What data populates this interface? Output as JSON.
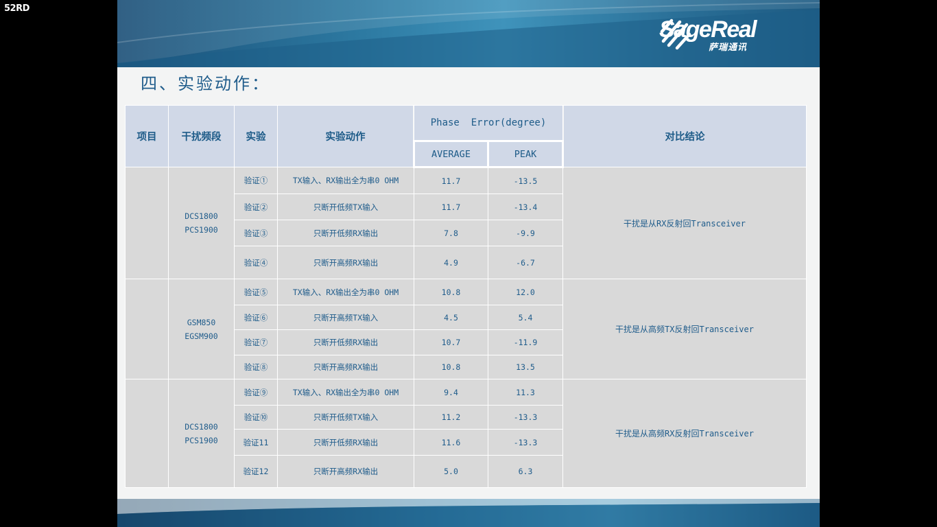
{
  "watermark": "52RD",
  "logo": {
    "name": "SageReal",
    "subtitle": "萨瑞通讯"
  },
  "title": "四、实验动作：",
  "table": {
    "headers": {
      "item": "项目",
      "band": "干扰频段",
      "experiment": "实验",
      "action": "实验动作",
      "phase_error": "Phase  Error(degree)",
      "average": "AVERAGE",
      "peak": "PEAK",
      "conclusion": "对比结论"
    },
    "groups": [
      {
        "item": "",
        "band": [
          "DCS1800",
          "PCS1900"
        ],
        "conclusion": "干扰是从RX反射回Transceiver",
        "rows": [
          {
            "exp": "验证①",
            "action": "TX输入、RX输出全为串0 OHM",
            "average": "11.7",
            "peak": "-13.5"
          },
          {
            "exp": "验证②",
            "action": "只断开低频TX输入",
            "average": "11.7",
            "peak": "-13.4"
          },
          {
            "exp": "验证③",
            "action": "只断开低频RX输出",
            "average": "7.8",
            "peak": "-9.9"
          },
          {
            "exp": "验证④",
            "action": "只断开高频RX输出",
            "average": "4.9",
            "peak": "-6.7"
          }
        ]
      },
      {
        "item": "",
        "band": [
          "GSM850",
          "EGSM900"
        ],
        "conclusion": "干扰是从高频TX反射回Transceiver",
        "rows": [
          {
            "exp": "验证⑤",
            "action": "TX输入、RX输出全为串0 OHM",
            "average": "10.8",
            "peak": "12.0"
          },
          {
            "exp": "验证⑥",
            "action": "只断开高频TX输入",
            "average": "4.5",
            "peak": "5.4"
          },
          {
            "exp": "验证⑦",
            "action": "只断开低频RX输出",
            "average": "10.7",
            "peak": "-11.9"
          },
          {
            "exp": "验证⑧",
            "action": "只断开高频RX输出",
            "average": "10.8",
            "peak": "13.5"
          }
        ]
      },
      {
        "item": "",
        "band": [
          "DCS1800",
          "PCS1900"
        ],
        "conclusion": "干扰是从高频RX反射回Transceiver",
        "rows": [
          {
            "exp": "验证⑨",
            "action": "TX输入、RX输出全为串0 OHM",
            "average": "9.4",
            "peak": "11.3"
          },
          {
            "exp": "验证⑩",
            "action": "只断开低频TX输入",
            "average": "11.2",
            "peak": "-13.3"
          },
          {
            "exp": "验证11",
            "action": "只断开低频RX输出",
            "average": "11.6",
            "peak": "-13.3"
          },
          {
            "exp": "验证12",
            "action": "只断开高频RX输出",
            "average": "5.0",
            "peak": "6.3"
          }
        ]
      }
    ]
  }
}
